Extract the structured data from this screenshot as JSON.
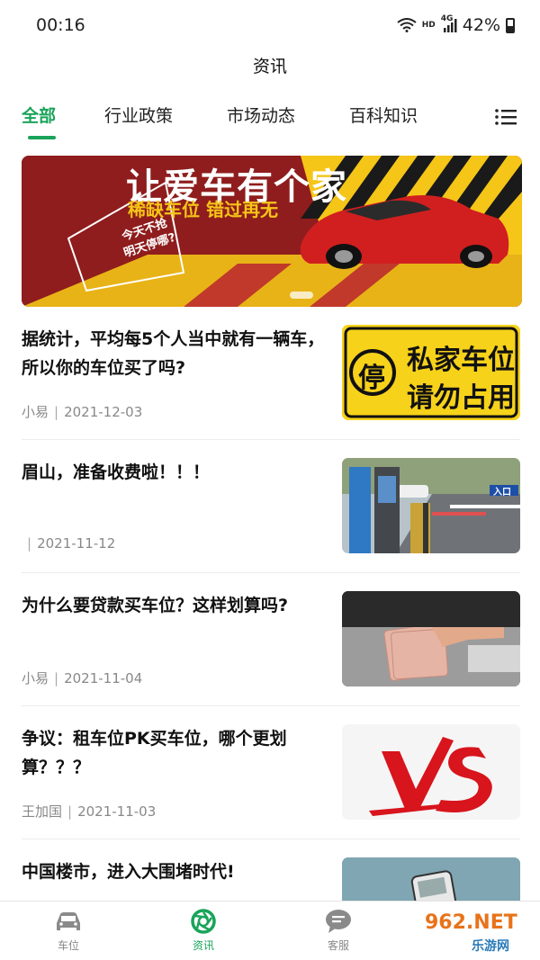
{
  "status_bar": {
    "time": "00:16",
    "network": "HD",
    "signal": "4G",
    "battery": "42%"
  },
  "header": {
    "title": "资讯"
  },
  "tabs": [
    {
      "label": "全部",
      "active": true
    },
    {
      "label": "行业政策",
      "active": false
    },
    {
      "label": "市场动态",
      "active": false
    },
    {
      "label": "百科知识",
      "active": false
    }
  ],
  "banner": {
    "title": "让爱车有个家",
    "subtitle": "稀缺车位 错过再无",
    "tag_line1": "今天不抢",
    "tag_line2": "明天停哪?"
  },
  "articles": [
    {
      "title": "据统计，平均每5个人当中就有一辆车，所以你的车位买了吗?",
      "author": "小易",
      "date": "2021-12-03",
      "thumb": "private-parking-sign",
      "thumb_text1": "私家车位",
      "thumb_text2": "请勿占用",
      "thumb_symbol": "停"
    },
    {
      "title": "眉山，准备收费啦！！！",
      "author": "",
      "date": "2021-11-12",
      "thumb": "parking-gate-photo",
      "thumb_text1": "入口"
    },
    {
      "title": "为什么要贷款买车位？这样划算吗?",
      "author": "小易",
      "date": "2021-11-04",
      "thumb": "cash-counting-photo"
    },
    {
      "title": "争议：租车位PK买车位，哪个更划算？？？",
      "author": "王加国",
      "date": "2021-11-03",
      "thumb": "vs-graphic"
    },
    {
      "title": "中国楼市，进入大围堵时代!",
      "author": "",
      "date": "",
      "thumb": "phone-hand-photo"
    }
  ],
  "bottom_nav": [
    {
      "label": "车位",
      "icon": "car-icon",
      "active": false
    },
    {
      "label": "资讯",
      "icon": "aperture-icon",
      "active": true
    },
    {
      "label": "客服",
      "icon": "chat-icon",
      "active": false
    }
  ],
  "watermark": {
    "text": "962.NET",
    "subtext": "乐游网"
  },
  "colors": {
    "accent": "#1aa35a",
    "banner_red": "#8f1d1d",
    "banner_yellow": "#f5c518"
  }
}
